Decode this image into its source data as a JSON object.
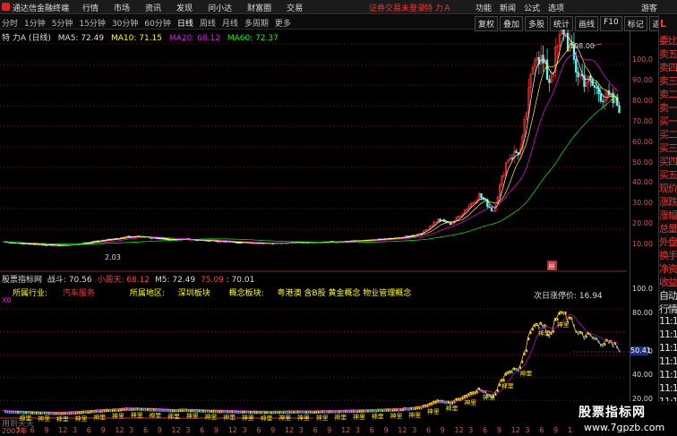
{
  "topbar": {
    "app_title": "通达信金融终端",
    "menus": [
      "行情",
      "市场",
      "资讯",
      "发现",
      "问小达",
      "财富圈",
      "交易"
    ],
    "warning": "证券交易未登录",
    "stock": "特 力Ａ",
    "right_menus": [
      "功能",
      "新闻",
      "公式",
      "选项"
    ],
    "guest": "游客"
  },
  "toolbar": {
    "periods": [
      "分时",
      "1分钟",
      "5分钟",
      "15分钟",
      "30分钟",
      "60分钟",
      "日线",
      "周线",
      "月线",
      "多周期",
      "更多"
    ],
    "active_period": "日线",
    "tools": [
      "复权",
      "叠加",
      "多股",
      "统计",
      "画线",
      "F10",
      "标记",
      "返回"
    ]
  },
  "main": {
    "title": "特 力A (日线)",
    "ma5": "MA5: 72.49",
    "ma10": "MA10: 71.15",
    "ma20": "MA20: 68.12",
    "ma60": "MA60: 72.37",
    "high_label": "108.00",
    "low_label": "2.03",
    "marker_label": "屉",
    "yticks": [
      "100.0",
      "90.00",
      "80.00",
      "70.00",
      "60.00",
      "50.00",
      "40.00",
      "30.00",
      "20.00",
      "10.00"
    ]
  },
  "sub": {
    "source": "股票指标网",
    "zhandou": "战斗: 70.56",
    "xiaoyoutian": "小周天: 68.12",
    "m5": "M5: 72.49",
    "v1": "75.09",
    "v2": ": 70.01",
    "industry_label": "所属行业:",
    "industry": "汽车服务",
    "region_label": "所属地区:",
    "region": "深圳板块",
    "concept_label": "概念板块:",
    "concepts": "粤港澳 含B股 黄金概念 物业管理概念",
    "x0": "X0",
    "next_limit": "次日涨停价: 16.94",
    "price_tag": "50.41",
    "yticks": [
      "100.0",
      "80.00",
      "60.00",
      "40.00",
      "20.00"
    ],
    "bottom_text": "用到天天",
    "buy_label": "神里"
  },
  "xaxis": {
    "labels": [
      "2007年",
      "3",
      "6",
      "9",
      "12",
      "3",
      "6",
      "9",
      "12",
      "3",
      "6",
      "9",
      "12",
      "3",
      "6",
      "9",
      "12",
      "3",
      "6",
      "9",
      "12",
      "3",
      "6",
      "9",
      "12",
      "3",
      "6",
      "9",
      "12",
      "3",
      "6",
      "9",
      "12",
      "3",
      "6",
      "9",
      "12",
      "3",
      "6",
      "9",
      "12",
      "3",
      "6",
      "9"
    ]
  },
  "side": {
    "top_icon": "L",
    "items": [
      "委比",
      "卖五",
      "卖四",
      "卖三",
      "卖二",
      "卖一",
      "买一",
      "买二",
      "买三",
      "买四",
      "买五",
      "现价",
      "涨跌",
      "涨幅",
      "总量",
      "外盘",
      "换手",
      "净资",
      "收益",
      "自动",
      "行情"
    ],
    "times": [
      "11:1",
      "11:1",
      "11:1",
      "11:1",
      "11:1",
      "11:1",
      "11:1"
    ]
  },
  "watermark": {
    "title": "股票指标网",
    "url": "www.7gpzb.com"
  },
  "chart_data": {
    "type": "line",
    "series": [
      {
        "name": "特力A",
        "values": [
          4,
          3.2,
          2.8,
          2.4,
          2.03,
          2.6,
          3.6,
          4.6,
          5.6,
          6.4,
          6.5,
          5.3,
          4.9,
          5.3,
          4.6,
          4.3,
          3.9,
          3.6,
          3.3,
          3.2,
          3.4,
          3.5,
          3.5,
          3.9,
          3.8,
          4.3,
          4.5,
          5.2,
          5.6,
          6.6,
          8.6,
          14.6,
          12.6,
          19.6,
          26.6,
          18.6,
          44.6,
          48.6,
          98.6,
          82.6,
          108,
          86,
          80,
          74,
          70
        ]
      }
    ],
    "ylim": [
      0,
      110
    ],
    "colors": {
      "up": "#ff3030",
      "down": "#54fcfc",
      "ma5": "#ffffff",
      "ma10": "#ffff00",
      "ma20": "#ff00ff",
      "ma60": "#00ff00"
    }
  }
}
